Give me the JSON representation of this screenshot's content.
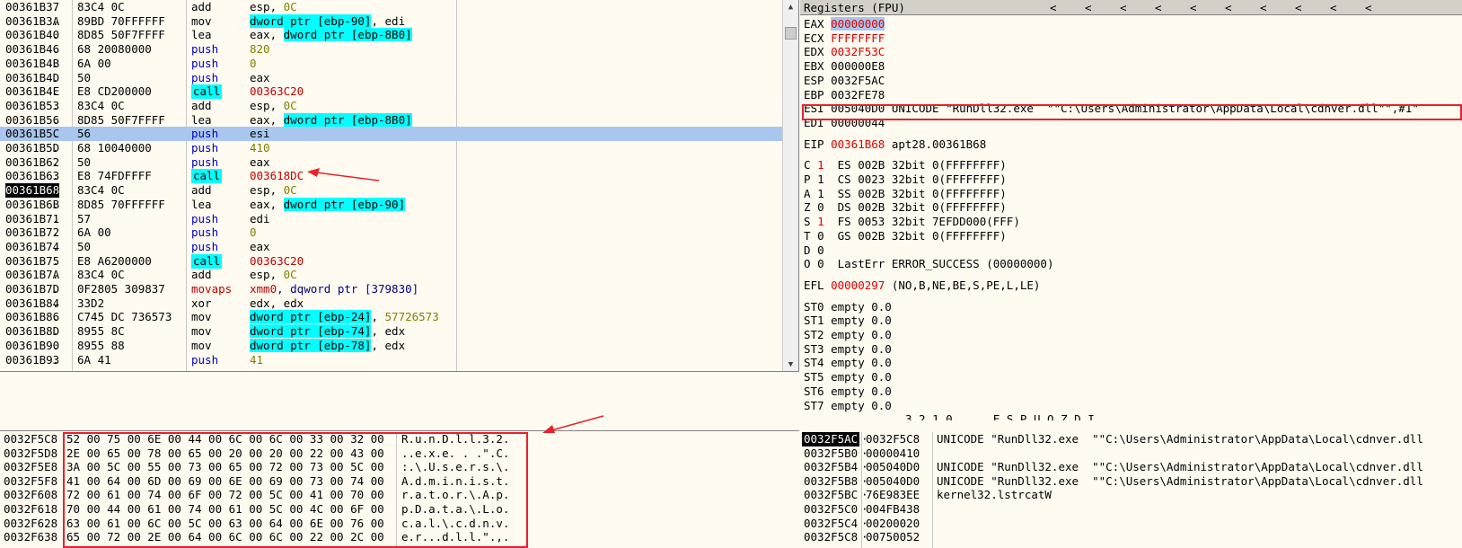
{
  "disasm": {
    "rows": [
      {
        "addr": "00361B37",
        "dot": ".",
        "hex": "83C4 0C",
        "mn": "add",
        "op": "esp, 0C",
        "mnStyle": "",
        "opParts": [
          [
            "esp, ",
            ""
          ],
          [
            "0C",
            "olive"
          ]
        ]
      },
      {
        "addr": "00361B3A",
        "dot": ".",
        "hex": "89BD 70FFFFFF",
        "mn": "mov",
        "op": "",
        "mnStyle": "",
        "opParts": [
          [
            "dword ptr [ebp-90]",
            "cyan"
          ],
          [
            ", edi",
            ""
          ]
        ]
      },
      {
        "addr": "00361B40",
        "dot": ".",
        "hex": "8D85 50F7FFFF",
        "mn": "lea",
        "op": "",
        "mnStyle": "",
        "opParts": [
          [
            "eax, ",
            ""
          ],
          [
            "dword ptr [ebp-8B0]",
            "cyan"
          ]
        ]
      },
      {
        "addr": "00361B46",
        "dot": ".",
        "hex": "68 20080000",
        "mn": "push",
        "op": "",
        "mnStyle": "blue",
        "opParts": [
          [
            "820",
            "olive"
          ]
        ]
      },
      {
        "addr": "00361B4B",
        "dot": ".",
        "hex": "6A 00",
        "mn": "push",
        "op": "",
        "mnStyle": "blue",
        "opParts": [
          [
            "0",
            "olive"
          ]
        ]
      },
      {
        "addr": "00361B4D",
        "dot": ".",
        "hex": "50",
        "mn": "push",
        "op": "",
        "mnStyle": "blue",
        "opParts": [
          [
            "eax",
            ""
          ]
        ]
      },
      {
        "addr": "00361B4E",
        "dot": ".",
        "hex": "E8 CD200000",
        "mn": "call",
        "op": "",
        "mnStyle": "call",
        "opParts": [
          [
            "00363C20",
            "red"
          ]
        ]
      },
      {
        "addr": "00361B53",
        "dot": ".",
        "hex": "83C4 0C",
        "mn": "add",
        "op": "",
        "mnStyle": "",
        "opParts": [
          [
            "esp, ",
            ""
          ],
          [
            "0C",
            "olive"
          ]
        ]
      },
      {
        "addr": "00361B56",
        "dot": ".",
        "hex": "8D85 50F7FFFF",
        "mn": "lea",
        "op": "",
        "mnStyle": "",
        "opParts": [
          [
            "eax, ",
            ""
          ],
          [
            "dword ptr [ebp-8B0]",
            "cyan"
          ]
        ]
      },
      {
        "addr": "00361B5C",
        "dot": ".",
        "hex": "56",
        "mn": "push",
        "op": "",
        "mnStyle": "blue",
        "opParts": [
          [
            "esi",
            ""
          ]
        ]
      },
      {
        "addr": "00361B5D",
        "dot": ".",
        "hex": "68 10040000",
        "mn": "push",
        "op": "",
        "mnStyle": "blue",
        "opParts": [
          [
            "410",
            "olive"
          ]
        ]
      },
      {
        "addr": "00361B62",
        "dot": ".",
        "hex": "50",
        "mn": "push",
        "op": "",
        "mnStyle": "blue",
        "opParts": [
          [
            "eax",
            ""
          ]
        ]
      },
      {
        "addr": "00361B63",
        "dot": ".",
        "hex": "E8 74FDFFFF",
        "mn": "call",
        "op": "",
        "mnStyle": "call",
        "opParts": [
          [
            "003618DC",
            "red"
          ]
        ]
      },
      {
        "addr": "00361B68",
        "dot": ".",
        "hex": "83C4 0C",
        "mn": "add",
        "op": "",
        "mnStyle": "",
        "opParts": [
          [
            "esp, ",
            ""
          ],
          [
            "0C",
            "olive"
          ]
        ]
      },
      {
        "addr": "00361B6B",
        "dot": ".",
        "hex": "8D85 70FFFFFF",
        "mn": "lea",
        "op": "",
        "mnStyle": "",
        "opParts": [
          [
            "eax, ",
            ""
          ],
          [
            "dword ptr [ebp-90]",
            "cyan"
          ]
        ]
      },
      {
        "addr": "00361B71",
        "dot": ".",
        "hex": "57",
        "mn": "push",
        "op": "",
        "mnStyle": "blue",
        "opParts": [
          [
            "edi",
            ""
          ]
        ]
      },
      {
        "addr": "00361B72",
        "dot": ".",
        "hex": "6A 00",
        "mn": "push",
        "op": "",
        "mnStyle": "blue",
        "opParts": [
          [
            "0",
            "olive"
          ]
        ]
      },
      {
        "addr": "00361B74",
        "dot": ".",
        "hex": "50",
        "mn": "push",
        "op": "",
        "mnStyle": "blue",
        "opParts": [
          [
            "eax",
            ""
          ]
        ]
      },
      {
        "addr": "00361B75",
        "dot": ".",
        "hex": "E8 A6200000",
        "mn": "call",
        "op": "",
        "mnStyle": "call",
        "opParts": [
          [
            "00363C20",
            "red"
          ]
        ]
      },
      {
        "addr": "00361B7A",
        "dot": ".",
        "hex": "83C4 0C",
        "mn": "add",
        "op": "",
        "mnStyle": "",
        "opParts": [
          [
            "esp, ",
            ""
          ],
          [
            "0C",
            "olive"
          ]
        ]
      },
      {
        "addr": "00361B7D",
        "dot": ".",
        "hex": "0F2805 309837",
        "mn": "movaps",
        "op": "",
        "mnStyle": "red",
        "opParts": [
          [
            "xmm0",
            "red"
          ],
          [
            ", dqword ptr [379830]",
            "navy"
          ]
        ]
      },
      {
        "addr": "00361B84",
        "dot": ".",
        "hex": "33D2",
        "mn": "xor",
        "op": "",
        "mnStyle": "",
        "opParts": [
          [
            "edx, edx",
            ""
          ]
        ]
      },
      {
        "addr": "00361B86",
        "dot": ".",
        "hex": "C745 DC 736573",
        "mn": "mov",
        "op": "",
        "mnStyle": "",
        "opParts": [
          [
            "dword ptr [ebp-24]",
            "cyan"
          ],
          [
            ", ",
            ""
          ],
          [
            "57726573",
            "olive"
          ]
        ]
      },
      {
        "addr": "00361B8D",
        "dot": ".",
        "hex": "8955 8C",
        "mn": "mov",
        "op": "",
        "mnStyle": "",
        "opParts": [
          [
            "dword ptr [ebp-74]",
            "cyan"
          ],
          [
            ", edx",
            ""
          ]
        ]
      },
      {
        "addr": "00361B90",
        "dot": ".",
        "hex": "8955 88",
        "mn": "mov",
        "op": "",
        "mnStyle": "",
        "opParts": [
          [
            "dword ptr [ebp-78]",
            "cyan"
          ],
          [
            ", edx",
            ""
          ]
        ]
      },
      {
        "addr": "00361B93",
        "dot": ".",
        "hex": "6A 41",
        "mn": "push",
        "op": "",
        "mnStyle": "blue",
        "opParts": [
          [
            "41",
            "olive"
          ]
        ]
      }
    ],
    "selected_index": 9,
    "eip_index": 13
  },
  "dump": {
    "rows": [
      {
        "addr": "0032F5C8",
        "hex": "52 00 75 00 6E 00 44 00 6C 00 6C 00 33 00 32 00",
        "ascii": "R.u.n.D.l.l.3.2."
      },
      {
        "addr": "0032F5D8",
        "hex": "2E 00 65 00 78 00 65 00 20 00 20 00 22 00 43 00",
        "ascii": "..e.x.e. . .\".C."
      },
      {
        "addr": "0032F5E8",
        "hex": "3A 00 5C 00 55 00 73 00 65 00 72 00 73 00 5C 00",
        "ascii": ":.\\.U.s.e.r.s.\\."
      },
      {
        "addr": "0032F5F8",
        "hex": "41 00 64 00 6D 00 69 00 6E 00 69 00 73 00 74 00",
        "ascii": "A.d.m.i.n.i.s.t."
      },
      {
        "addr": "0032F608",
        "hex": "72 00 61 00 74 00 6F 00 72 00 5C 00 41 00 70 00",
        "ascii": "r.a.t.o.r.\\.A.p."
      },
      {
        "addr": "0032F618",
        "hex": "70 00 44 00 61 00 74 00 61 00 5C 00 4C 00 6F 00",
        "ascii": "p.D.a.t.a.\\.L.o."
      },
      {
        "addr": "0032F628",
        "hex": "63 00 61 00 6C 00 5C 00 63 00 64 00 6E 00 76 00",
        "ascii": "c.a.l.\\.c.d.n.v."
      },
      {
        "addr": "0032F638",
        "hex": "65 00 72 00 2E 00 64 00 6C 00 6C 00 22 00 2C 00",
        "ascii": "e.r...d.l.l.\".,."
      }
    ]
  },
  "registers": {
    "title": "Registers (FPU)",
    "arrow": "<",
    "gpr": [
      {
        "name": "EAX",
        "val": "00000000",
        "style": "hl",
        "extra": ""
      },
      {
        "name": "ECX",
        "val": "FFFFFFFF",
        "style": "red",
        "extra": ""
      },
      {
        "name": "EDX",
        "val": "0032F53C",
        "style": "red",
        "extra": ""
      },
      {
        "name": "EBX",
        "val": "000000E8",
        "style": "",
        "extra": ""
      },
      {
        "name": "ESP",
        "val": "0032F5AC",
        "style": "",
        "extra": ""
      },
      {
        "name": "EBP",
        "val": "0032FE78",
        "style": "",
        "extra": ""
      },
      {
        "name": "ESI",
        "val": "005040D0",
        "style": "",
        "extra": "UNICODE \"RunDll32.exe  \"\"C:\\Users\\Administrator\\AppData\\Local\\cdnver.dll\"\",#1\""
      },
      {
        "name": "EDI",
        "val": "00000044",
        "style": "",
        "extra": ""
      }
    ],
    "eip": {
      "name": "EIP",
      "val": "00361B68",
      "extra": "apt28.00361B68"
    },
    "flags": [
      {
        "f": "C",
        "v": "1",
        "seg": "ES 002B 32bit 0(FFFFFFFF)",
        "red": true
      },
      {
        "f": "P",
        "v": "1",
        "seg": "CS 0023 32bit 0(FFFFFFFF)",
        "red": false
      },
      {
        "f": "A",
        "v": "1",
        "seg": "SS 002B 32bit 0(FFFFFFFF)",
        "red": false
      },
      {
        "f": "Z",
        "v": "0",
        "seg": "DS 002B 32bit 0(FFFFFFFF)",
        "red": false
      },
      {
        "f": "S",
        "v": "1",
        "seg": "FS 0053 32bit 7EFDD000(FFF)",
        "red": true
      },
      {
        "f": "T",
        "v": "0",
        "seg": "GS 002B 32bit 0(FFFFFFFF)",
        "red": false
      },
      {
        "f": "D",
        "v": "0",
        "seg": "",
        "red": false
      },
      {
        "f": "O",
        "v": "0",
        "seg": "LastErr ERROR_SUCCESS (00000000)",
        "red": false
      }
    ],
    "efl": {
      "name": "EFL",
      "val": "00000297",
      "extra": "(NO,B,NE,BE,S,PE,L,LE)"
    },
    "st": [
      "ST0 empty 0.0",
      "ST1 empty 0.0",
      "ST2 empty 0.0",
      "ST3 empty 0.0",
      "ST4 empty 0.0",
      "ST5 empty 0.0",
      "ST6 empty 0.0",
      "ST7 empty 0.0"
    ],
    "fpu_header": "3 2 1 0      E S P U O Z D I"
  },
  "stack": {
    "rows": [
      {
        "addr": "0032F5AC",
        "val": "0032F5C8",
        "comment": "UNICODE \"RunDll32.exe  \"\"C:\\Users\\Administrator\\AppData\\Local\\cdnver.dll"
      },
      {
        "addr": "0032F5B0",
        "val": "00000410",
        "comment": ""
      },
      {
        "addr": "0032F5B4",
        "val": "005040D0",
        "comment": "UNICODE \"RunDll32.exe  \"\"C:\\Users\\Administrator\\AppData\\Local\\cdnver.dll"
      },
      {
        "addr": "0032F5B8",
        "val": "005040D0",
        "comment": "UNICODE \"RunDll32.exe  \"\"C:\\Users\\Administrator\\AppData\\Local\\cdnver.dll"
      },
      {
        "addr": "0032F5BC",
        "val": "76E983EE",
        "comment": "kernel32.lstrcatW"
      },
      {
        "addr": "0032F5C0",
        "val": "004FB438",
        "comment": ""
      },
      {
        "addr": "0032F5C4",
        "val": "00200020",
        "comment": ""
      },
      {
        "addr": "0032F5C8",
        "val": "00750052",
        "comment": ""
      }
    ],
    "sep": "·"
  }
}
